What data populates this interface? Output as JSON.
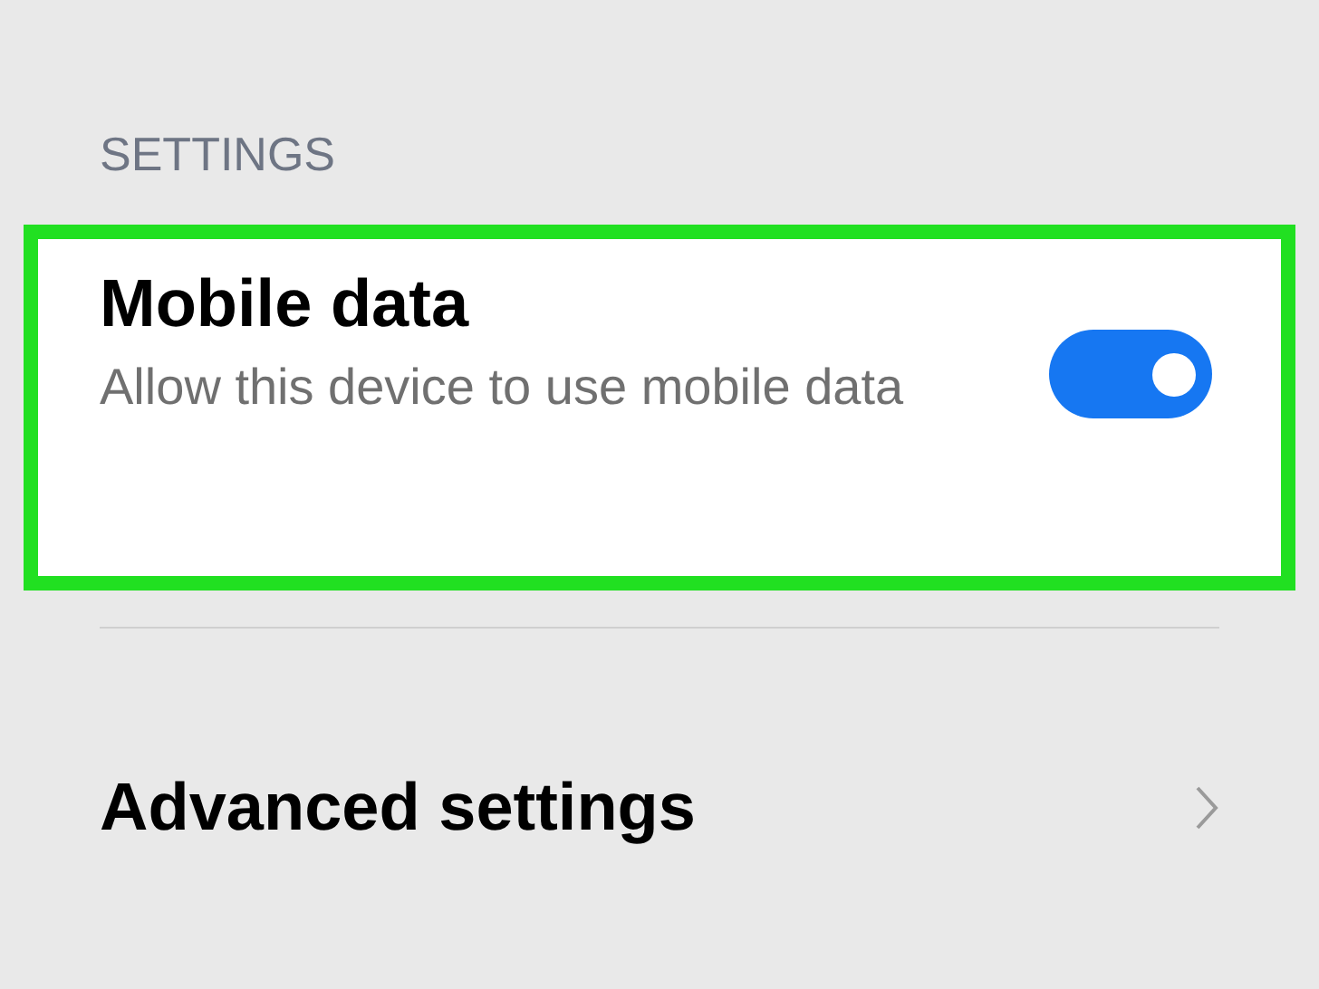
{
  "section_header": "SETTINGS",
  "mobile_data": {
    "title": "Mobile data",
    "subtitle": "Allow this device to use mobile data",
    "on": true,
    "highlighted": true
  },
  "advanced_settings": {
    "label": "Advanced settings"
  }
}
